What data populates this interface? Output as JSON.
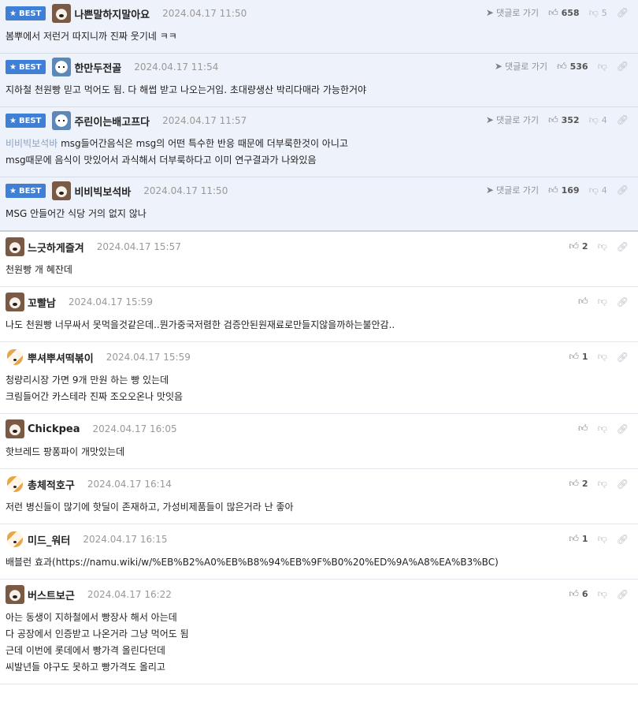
{
  "labels": {
    "best": "BEST",
    "goto": "댓글로 가기",
    "icon_thumb_up": "thumb-up-icon",
    "icon_thumb_down": "thumb-down-icon",
    "icon_link": "link-icon",
    "icon_arrow": "arrow-icon",
    "icon_star": "star-icon"
  },
  "best_comments": [
    {
      "nick": "나쁜말하지말아요",
      "time": "2024.04.17 11:50",
      "up": "658",
      "down": "5",
      "text": "봄뿌에서 저런거 따지니까 진짜 웃기네 ㅋㅋ"
    },
    {
      "nick": "한만두전골",
      "time": "2024.04.17 11:54",
      "up": "536",
      "down": "",
      "text": "지하철 천원빵 믿고 먹어도 됨. 다 해썹 받고 나오는거임. 초대량생산 박리다매라 가능한거야"
    },
    {
      "nick": "주린이는배고프다",
      "time": "2024.04.17 11:57",
      "up": "352",
      "down": "4",
      "tag": "비비빅보석바",
      "text": " msg들어간음식은 msg의 어떤 특수한 반응 때문에 더부룩한것이 아니고\nmsg때문에 음식이 맛있어서 과식해서 더부룩하다고 이미 연구결과가 나와있음"
    },
    {
      "nick": "비비빅보석바",
      "time": "2024.04.17 11:50",
      "up": "169",
      "down": "4",
      "text": "MSG 안들어간 식당 거의 없지 않나"
    }
  ],
  "comments": [
    {
      "nick": "느긋하게즐겨",
      "time": "2024.04.17 15:57",
      "up": "2",
      "text": "천원빵 개 혜잔데"
    },
    {
      "nick": "꼬빨남",
      "time": "2024.04.17 15:59",
      "up": "",
      "text": "나도 천원빵 너무싸서 못먹을것같은데..뭔가중국저렴한 검증안된원재료로만들지않을까하는불안감.."
    },
    {
      "nick": "뿌셔뿌셔떡볶이",
      "time": "2024.04.17 15:59",
      "up": "1",
      "text": "청량리시장 가면 9개 만원 하는 빵 있는데\n크림들어간 카스테라 진짜 조오오온나 맛잇음"
    },
    {
      "nick": "Chickpea",
      "time": "2024.04.17 16:05",
      "up": "",
      "text": "핫브레드 팡퐁파이 개맛있는데"
    },
    {
      "nick": "총체적호구",
      "time": "2024.04.17 16:14",
      "up": "2",
      "text": "저런 병신들이 많기에 핫딜이 존재하고, 가성비제품들이 많은거라 난 좋아"
    },
    {
      "nick": "미드_워터",
      "time": "2024.04.17 16:15",
      "up": "1",
      "text": "배블런 효과(https://namu.wiki/w/%EB%B2%A0%EB%B8%94%EB%9F%B0%20%ED%9A%A8%EA%B3%BC)"
    },
    {
      "nick": "버스트보근",
      "time": "2024.04.17 16:22",
      "up": "6",
      "text": "아는 동생이 지하철에서 빵장사 해서 아는데\n다 공장에서 인증받고 나온거라 그냥 먹어도 됨\n근데 이번에 롯데에서 빵가격 올린다던데\n씨발년들 야구도 못하고 빵가격도 올리고"
    }
  ]
}
